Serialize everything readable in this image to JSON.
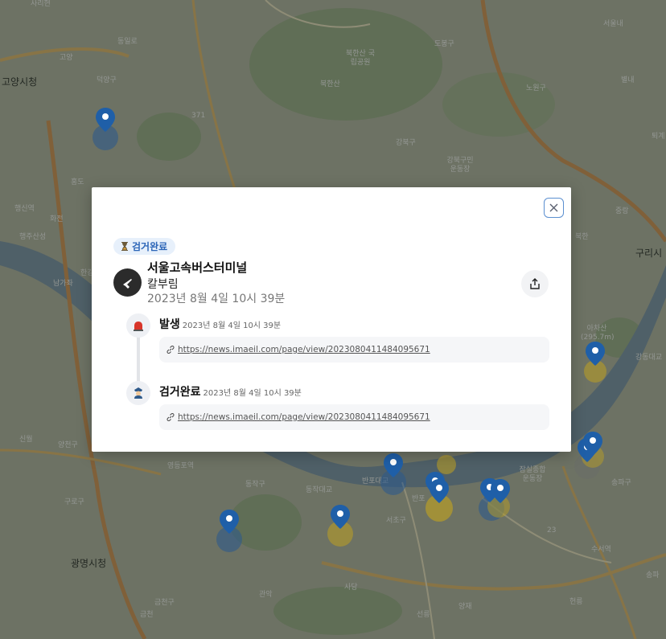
{
  "map": {
    "labels": [
      "사리현",
      "동일로",
      "고양",
      "덕양구",
      "고양시청",
      "371",
      "북한산 국립공원",
      "북한산",
      "도봉구",
      "노원구",
      "서울내",
      "별내",
      "퇴계",
      "강북구",
      "강북구민 운동장",
      "홍도",
      "행신역",
      "화전",
      "행주산성",
      "한강",
      "북한",
      "중랑",
      "구리시",
      "남가좌",
      "아차산 (295.7m)",
      "강동대교",
      "신월",
      "양천구",
      "영등포역",
      "동작구",
      "동작대교",
      "반포대교",
      "반포",
      "잠실종합 운동장",
      "송파구",
      "구로구",
      "서초구",
      "광명시청",
      "금천구",
      "관악",
      "사당",
      "선릉",
      "양재",
      "헌릉",
      "금천",
      "수서역",
      "송파",
      "23"
    ]
  },
  "modal": {
    "status_badge": "검거완료",
    "station": "서울고속버스터미널",
    "crime": "칼부림",
    "datetime": "2023년 8월 4일 10시 39분",
    "timeline": [
      {
        "title": "발생",
        "time": "2023년 8월 4일 10시 39분",
        "link": "https://news.imaeil.com/page/view/2023080411484095671",
        "icon": "siren-icon"
      },
      {
        "title": "검거완료",
        "time": "2023년 8월 4일 10시 39분",
        "link": "https://news.imaeil.com/page/view/2023080411484095671",
        "icon": "police-officer-icon"
      }
    ]
  },
  "colors": {
    "pin_blue": "#1f5fa8",
    "status_badge_bg": "#e7f0fb",
    "status_badge_text": "#2d66b8"
  }
}
